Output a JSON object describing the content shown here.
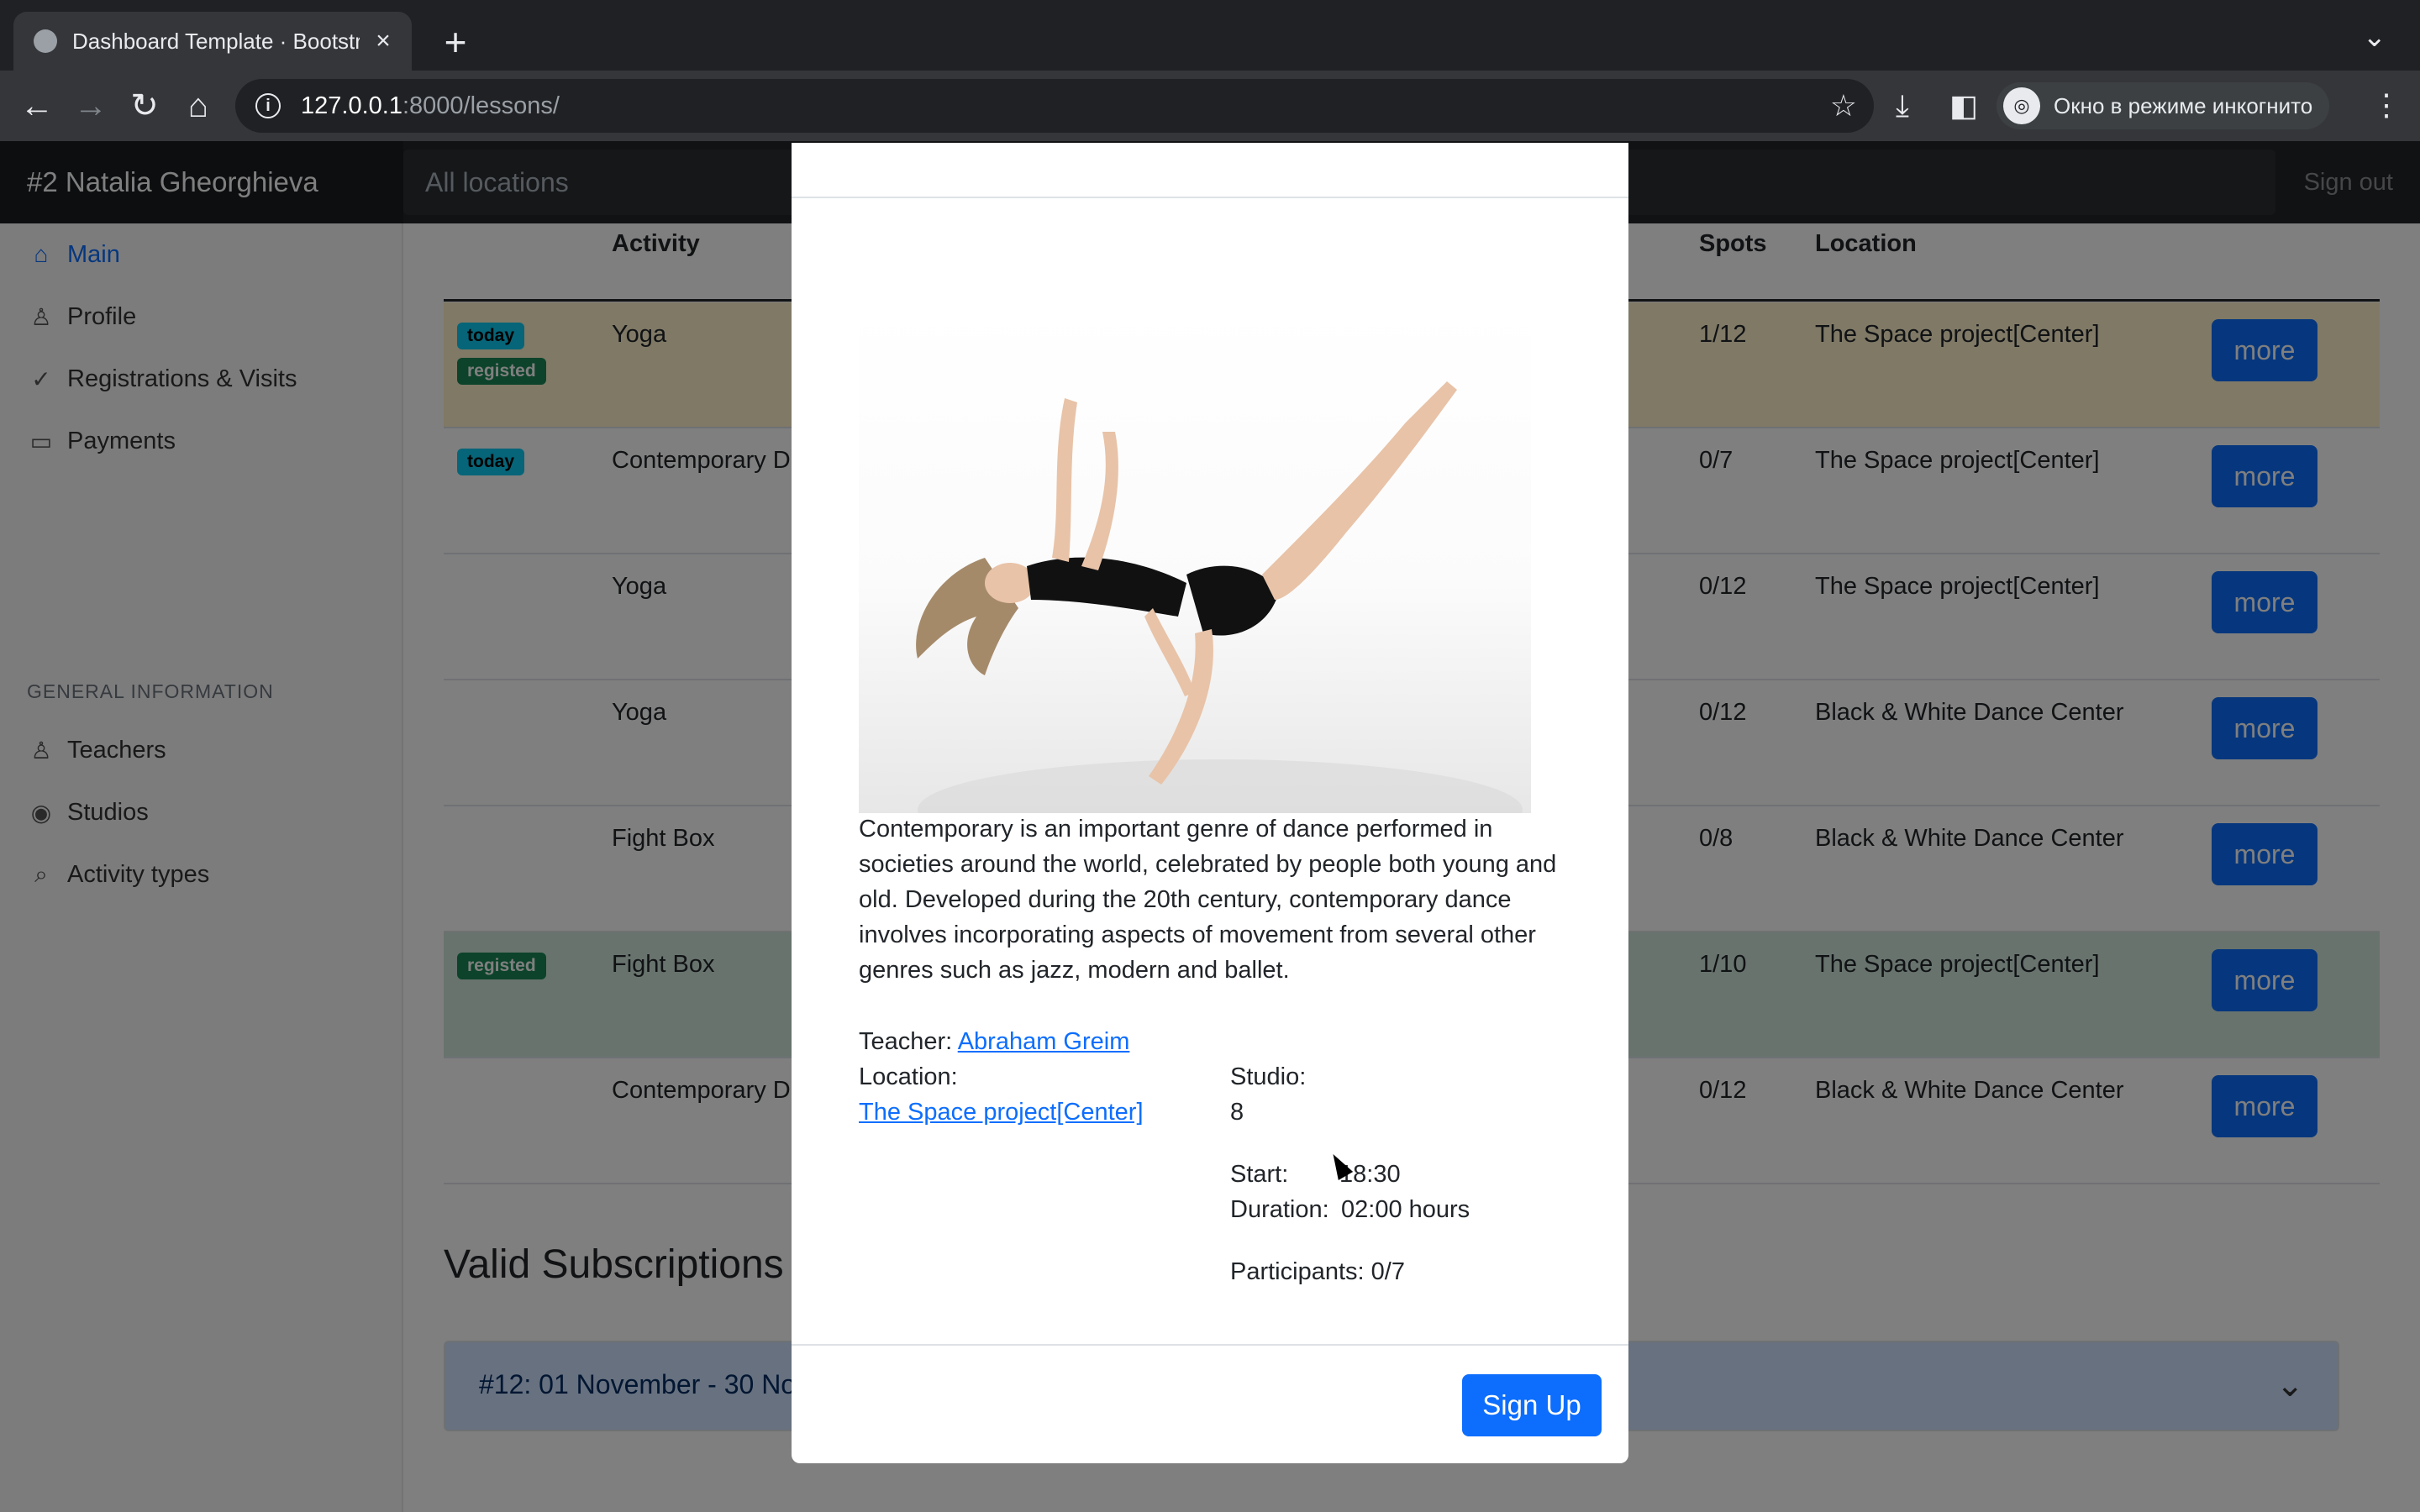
{
  "browser": {
    "tab_title": "Dashboard Template · Bootstra",
    "url_host": "127.0.0.1",
    "url_rest": ":8000/lessons/",
    "incognito_label": "Окно в режиме инкогнито"
  },
  "navbar": {
    "brand": "#2 Natalia Gheorghieva",
    "search_placeholder": "All locations",
    "signout": "Sign out"
  },
  "sidebar": {
    "items": [
      {
        "label": "Main",
        "icon": "home-icon"
      },
      {
        "label": "Profile",
        "icon": "user-icon"
      },
      {
        "label": "Registrations & Visits",
        "icon": "check-circle-icon"
      },
      {
        "label": "Payments",
        "icon": "credit-card-icon"
      }
    ],
    "heading": "GENERAL INFORMATION",
    "info_items": [
      {
        "label": "Teachers",
        "icon": "users-icon"
      },
      {
        "label": "Studios",
        "icon": "map-pin-icon"
      },
      {
        "label": "Activity types",
        "icon": "search-icon"
      }
    ]
  },
  "table": {
    "headers": {
      "activity": "Activity",
      "spots": "Spots",
      "location": "Location"
    },
    "more_label": "more",
    "rows": [
      {
        "badges": [
          "today",
          "registed"
        ],
        "activity": "Yoga",
        "spots": "1/12",
        "location": "The Space project[Center]",
        "state": "warn"
      },
      {
        "badges": [
          "today"
        ],
        "activity": "Contemporary D",
        "spots": "0/7",
        "location": "The Space project[Center]",
        "state": ""
      },
      {
        "badges": [],
        "activity": "Yoga",
        "spots": "0/12",
        "location": "The Space project[Center]",
        "state": ""
      },
      {
        "badges": [],
        "activity": "Yoga",
        "spots": "0/12",
        "location": "Black & White Dance Center",
        "state": ""
      },
      {
        "badges": [],
        "activity": "Fight Box",
        "spots": "0/8",
        "location": "Black & White Dance Center",
        "state": ""
      },
      {
        "badges": [
          "registed"
        ],
        "activity": "Fight Box",
        "spots": "1/10",
        "location": "The Space project[Center]",
        "state": "succ"
      },
      {
        "badges": [],
        "activity": "Contemporary D",
        "spots": "0/12",
        "location": "Black & White Dance Center",
        "state": ""
      }
    ]
  },
  "subscriptions": {
    "title": "Valid Subscriptions",
    "item": "#12: 01 November - 30 No"
  },
  "modal": {
    "description": "Contemporary is an important genre of dance performed in societies around the world, celebrated by people both young and old. Developed during the 20th century, contemporary dance involves incorporating aspects of movement from several other genres such as jazz, modern and ballet.",
    "teacher_label": "Teacher:",
    "teacher": "Abraham Greim",
    "location_label": "Location:",
    "location": "The Space project[Center]",
    "studio_label": "Studio:",
    "studio": "8",
    "start_label": "Start:",
    "start": "18:30",
    "duration_label": "Duration:",
    "duration": "02:00 hours",
    "participants_label": "Participants:",
    "participants": "0/7",
    "signup": "Sign Up"
  }
}
